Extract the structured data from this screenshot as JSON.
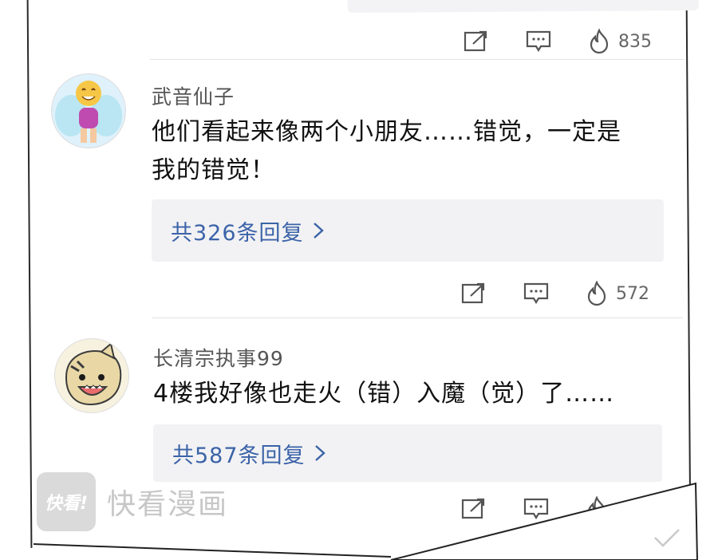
{
  "top_comment": {
    "like_count": "835"
  },
  "comments": [
    {
      "username": "武音仙子",
      "text_line1": "他们看起来像两个小朋友……错觉，一定是",
      "text_line2": "我的错觉！",
      "replies_label": "共326条回复",
      "like_count": "572"
    },
    {
      "username": "长清宗执事99",
      "text_line1": "4楼我好像也走火（错）入魔（觉）了……",
      "replies_label": "共587条回复",
      "like_count": ""
    }
  ],
  "watermark": {
    "logo_text": "快看!",
    "brand_text": "快看漫画"
  },
  "colors": {
    "reply_link": "#3b63a8",
    "reply_bg": "#f2f2f4",
    "icon_gray": "#555555"
  }
}
